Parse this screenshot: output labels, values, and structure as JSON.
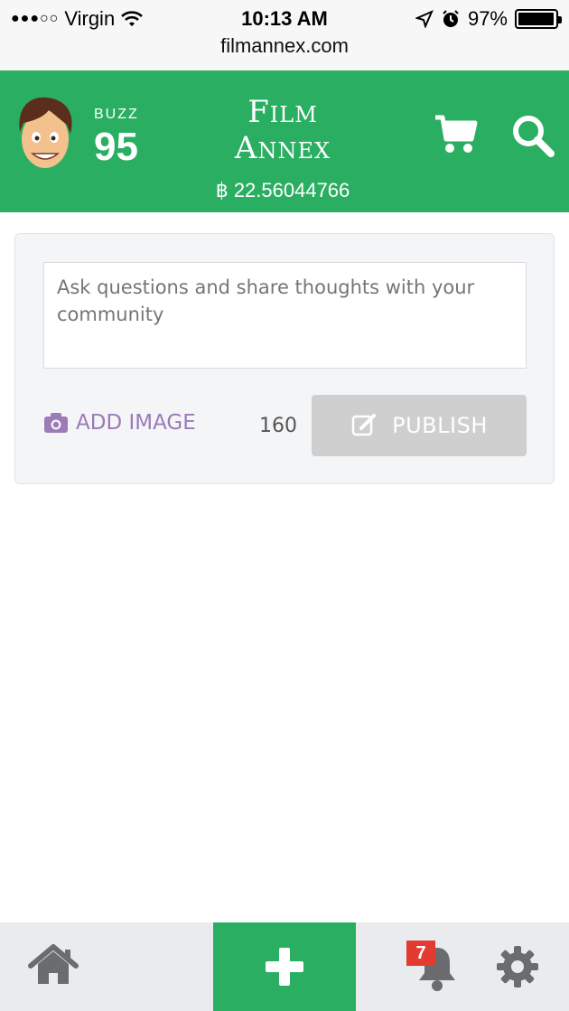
{
  "status_bar": {
    "signal": "●●●○○",
    "carrier": "Virgin",
    "time": "10:13 AM",
    "battery_percent": "97%",
    "battery_level": 0.97,
    "url": "filmannex.com"
  },
  "header": {
    "buzz_label": "BUZZ",
    "buzz_value": "95",
    "logo_text": "Film Annex",
    "balance": "฿ 22.56044766",
    "brand_color": "#2aae62"
  },
  "composer": {
    "placeholder": "Ask questions and share thoughts with your community",
    "add_image_label": "ADD IMAGE",
    "char_count": "160",
    "publish_label": "PUBLISH"
  },
  "bottom_nav": {
    "notification_count": "7",
    "icons": [
      "home-icon",
      "plus-icon",
      "bell-icon",
      "gear-icon"
    ]
  }
}
